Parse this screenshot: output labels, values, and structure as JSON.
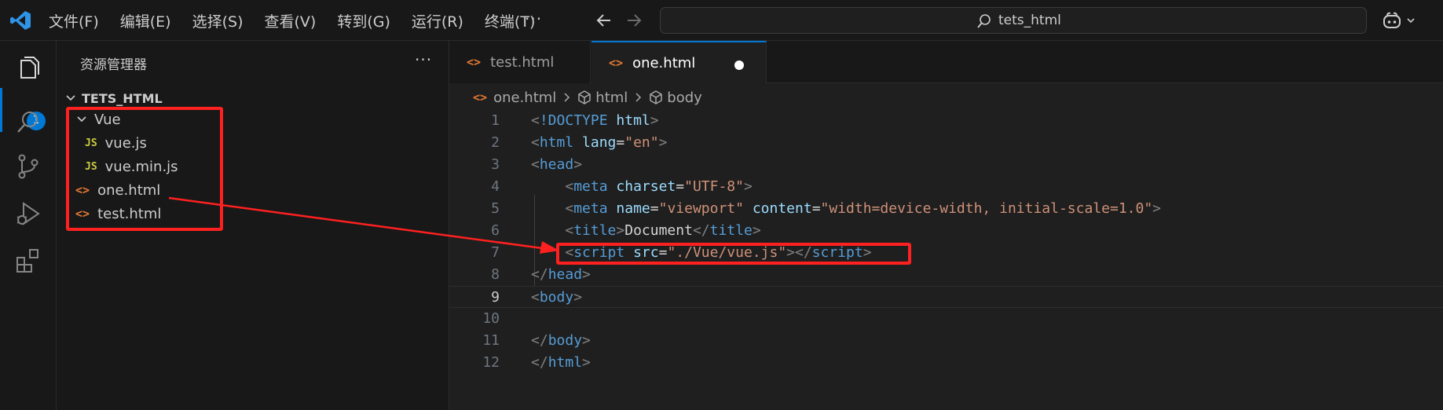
{
  "titlebar": {
    "menu": [
      "文件(F)",
      "编辑(E)",
      "选择(S)",
      "查看(V)",
      "转到(G)",
      "运行(R)",
      "终端(T)"
    ],
    "more": "···",
    "search_text": "tets_html"
  },
  "activity": {
    "badge": "1"
  },
  "sidebar": {
    "title": "资源管理器",
    "more": "···",
    "root": "TETS_HTML",
    "folder": "Vue",
    "files_in_folder": [
      "vue.js",
      "vue.min.js"
    ],
    "files": [
      "one.html",
      "test.html"
    ],
    "js_icon": "JS",
    "html_icon": "<>"
  },
  "tabs": [
    {
      "label": "test.html",
      "active": false
    },
    {
      "label": "one.html",
      "active": true,
      "dirty": true
    }
  ],
  "breadcrumb": [
    "one.html",
    "html",
    "body"
  ],
  "code_lines": [
    {
      "n": "1"
    },
    {
      "n": "2"
    },
    {
      "n": "3"
    },
    {
      "n": "4"
    },
    {
      "n": "5"
    },
    {
      "n": "6"
    },
    {
      "n": "7"
    },
    {
      "n": "8"
    },
    {
      "n": "9"
    },
    {
      "n": "10"
    },
    {
      "n": "11"
    },
    {
      "n": "12"
    }
  ],
  "code_text": {
    "l1_doctype": "!DOCTYPE",
    "l1_html": "html",
    "l2_tag": "html",
    "l2_attr": "lang",
    "l2_val": "\"en\"",
    "l3_tag": "head",
    "l4_tag": "meta",
    "l4_attr": "charset",
    "l4_val": "\"UTF-8\"",
    "l5_tag": "meta",
    "l5_attr1": "name",
    "l5_val1": "\"viewport\"",
    "l5_attr2": "content",
    "l5_val2": "\"width=device-width, initial-scale=1.0\"",
    "l6_tag": "title",
    "l6_text": "Document",
    "l7_tag": "script",
    "l7_attr": "src",
    "l7_val": "\"./Vue/vue.js\"",
    "l8_tag": "head",
    "l9_tag": "body",
    "l11_tag": "body",
    "l12_tag": "html"
  },
  "colors": {
    "accent": "#0078d4",
    "highlight": "#ff2020",
    "tag": "#569cd6",
    "attr": "#9cdcfe",
    "string": "#ce9178"
  }
}
